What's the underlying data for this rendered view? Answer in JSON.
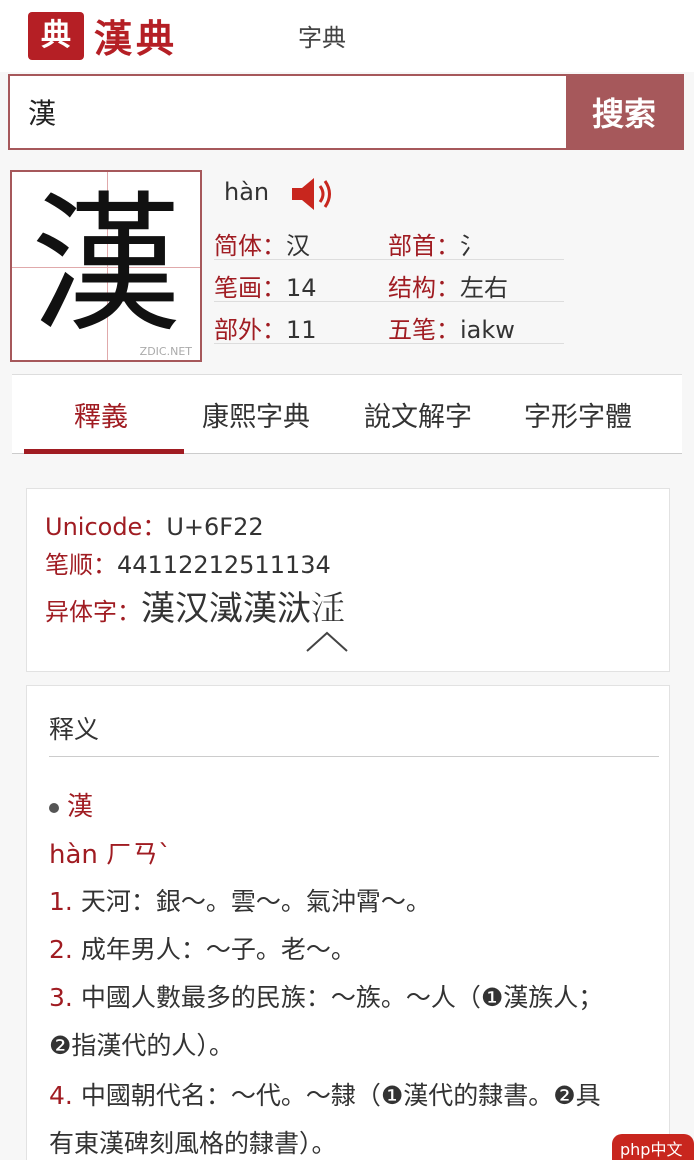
{
  "header": {
    "logo_seal": "典",
    "logo_text": "漢典",
    "nav_link": "字典"
  },
  "search": {
    "value": "漢",
    "button_label": "搜索"
  },
  "character": {
    "glyph": "漢",
    "pinyin": "hàn",
    "watermark": "ZDIC.NET"
  },
  "info": {
    "jianti_label": "简体：",
    "jianti_value": "汉",
    "bushou_label": "部首：",
    "bushou_value": "氵",
    "bihua_label": "笔画：",
    "bihua_value": "14",
    "jiegou_label": "结构：",
    "jiegou_value": "左右",
    "buwai_label": "部外：",
    "buwai_value": "11",
    "wubi_label": "五笔：",
    "wubi_value": "iakw"
  },
  "tabs": [
    "釋義",
    "康熙字典",
    "說文解字",
    "字形字體"
  ],
  "details": {
    "unicode_label": "Unicode：",
    "unicode_value": "U+6F22",
    "bishun_label": "笔顺：",
    "bishun_value": "44112212511134",
    "yiti_label": "异体字：",
    "yiti_value": "漢汉㵄漢𣴘𣳴"
  },
  "definition": {
    "section_title": "释义",
    "headword": "漢",
    "reading": "hàn ㄏㄢˋ",
    "items": [
      {
        "num": "1.",
        "text": "天河：銀～。雲～。氣沖霄～。"
      },
      {
        "num": "2.",
        "text": "成年男人：～子。老～。"
      },
      {
        "num": "3.",
        "text": "中國人數最多的民族：～族。～人（❶漢族人；"
      },
      {
        "num": "",
        "text": "❷指漢代的人）。"
      },
      {
        "num": "4.",
        "text": "中國朝代名：～代。～隸（❶漢代的隸書。❷具"
      },
      {
        "num": "",
        "text": "有東漢碑刻風格的隸書）。"
      }
    ]
  },
  "footer": {
    "site_logo": "php中文网"
  },
  "colors": {
    "accent": "#a01c22",
    "search_border": "#a6585b"
  }
}
